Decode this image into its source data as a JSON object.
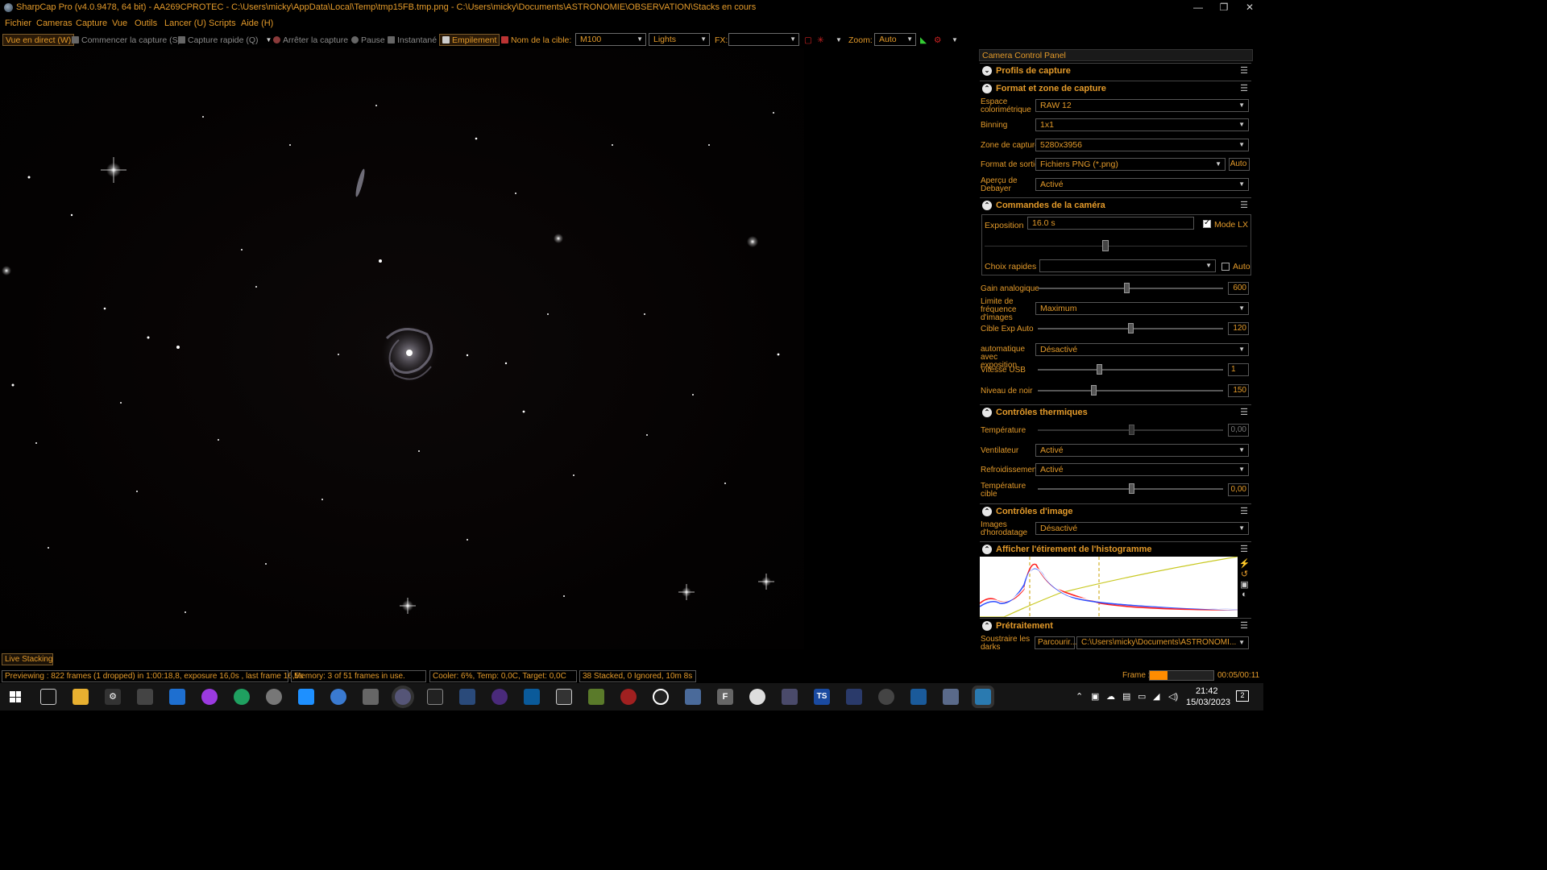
{
  "window": {
    "title": "SharpCap Pro (v4.0.9478, 64 bit) - AA269CPROTEC - C:\\Users\\micky\\AppData\\Local\\Temp\\tmp15FB.tmp.png - C:\\Users\\micky\\Documents\\ASTRONOMIE\\OBSERVATION\\Stacks en cours",
    "minimize": "—",
    "restore": "❐",
    "close": "✕"
  },
  "menu": [
    "Fichier",
    "Cameras",
    "Capture",
    "Vue",
    "Outils",
    "Lancer (U)",
    "Scripts",
    "Aide (H)"
  ],
  "toolbar": {
    "live_view": "Vue en direct (W)",
    "start_capture": "Commencer la capture (S)",
    "quick_capture": "Capture rapide (Q)",
    "stop_capture": "Arrêter la capture",
    "pause": "Pause",
    "snapshot": "Instantané",
    "stacking": "Empilement",
    "target_label": "Nom de la cible:",
    "target_value": "M100",
    "frame_type": "Lights",
    "fx_label": "FX:",
    "fx_value": "",
    "zoom_label": "Zoom:",
    "zoom_value": "Auto"
  },
  "panel": {
    "title": "Camera Control Panel",
    "sections": {
      "profiles": "Profils de capture",
      "format": "Format et zone de capture",
      "camera": "Commandes de la caméra",
      "thermal": "Contrôles thermiques",
      "image": "Contrôles d'image",
      "histogram": "Afficher l'étirement de l'histogramme",
      "preprocessing": "Prétraitement"
    },
    "format": {
      "colorspace_label": "Espace colorimétrique",
      "colorspace_value": "RAW 12",
      "binning_label": "Binning",
      "binning_value": "1x1",
      "zone_label": "Zone de capture",
      "zone_value": "5280x3956",
      "output_label": "Format de sortie",
      "output_value": "Fichiers PNG (*.png)",
      "output_auto": "Auto",
      "debayer_label": "Aperçu de Debayer",
      "debayer_value": "Activé"
    },
    "camera": {
      "exposure_label": "Exposition",
      "exposure_value": "16.0 s",
      "lx_mode": "Mode LX",
      "quick_label": "Choix rapides",
      "quick_auto": "Auto",
      "gain_label": "Gain analogique",
      "gain_value": "600",
      "gain_level": 0.48,
      "framerate_label": "Limite de fréquence d'images",
      "framerate_value": "Maximum",
      "autoexp_label": "Cible Exp Auto",
      "autoexp_value": "120",
      "autoexp_level": 0.5,
      "auto_with_exp_label": "automatique avec exposition",
      "auto_with_exp_value": "Désactivé",
      "usb_label": "Vitesse USB",
      "usb_value": "1",
      "usb_level": 0.33,
      "black_label": "Niveau de noir",
      "black_value": "150",
      "black_level": 0.3
    },
    "thermal": {
      "temp_label": "Température",
      "temp_value": "0,00",
      "fan_label": "Ventilateur",
      "fan_value": "Activé",
      "cooling_label": "Refroidissement",
      "cooling_value": "Activé",
      "target_temp_label": "Température cible",
      "target_temp_value": "0,00"
    },
    "image": {
      "timestamp_label": "Images d'horodatage",
      "timestamp_value": "Désactivé"
    },
    "preprocessing": {
      "darks_label": "Soustraire les darks",
      "browse": "Parcourir...",
      "path": "C:\\Users\\micky\\Documents\\ASTRONOMI..."
    }
  },
  "status": {
    "live_stacking": "Live Stacking",
    "previewing": "Previewing : 822 frames (1 dropped) in 1:00:18,8, exposure 16,0s , last frame 16,5s",
    "memory": "Memory: 3 of 51 frames in use.",
    "cooler": "Cooler: 6%, Temp: 0,0C, Target: 0,0C",
    "stacked": "38 Stacked, 0 Ignored, 10m 8s",
    "frame_label": "Frame :",
    "frame_progress": 0.28,
    "frame_time": "00:05/00:11"
  },
  "taskbar": {
    "time": "21:42",
    "date": "15/03/2023",
    "notif": "2"
  },
  "colors": {
    "accent": "#e39a2a",
    "histogram_red": "#ff2020",
    "histogram_blue": "#3050ff",
    "histogram_white": "#ffffff",
    "histogram_curve": "#c8c820"
  }
}
